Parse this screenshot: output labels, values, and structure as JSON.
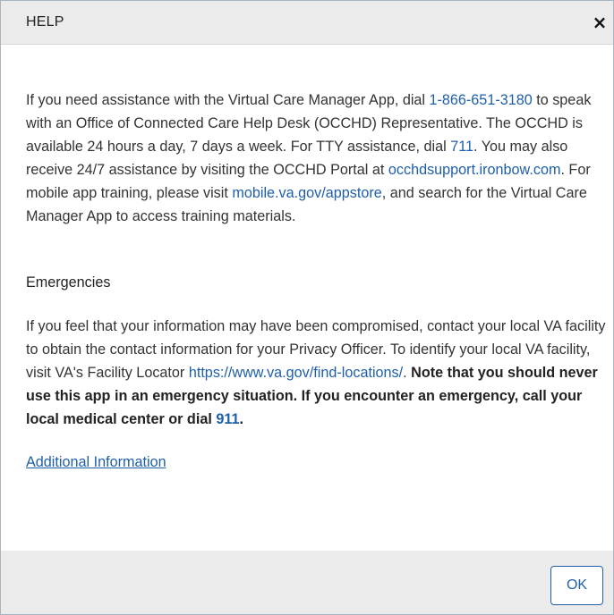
{
  "dialog": {
    "title": "HELP",
    "close_glyph": "×",
    "ok_label": "OK"
  },
  "help": {
    "t1": "If you need assistance with the Virtual Care Manager App, dial ",
    "phone": "1-866-651-3180",
    "t2": " to speak with an Office of Connected Care Help Desk (OCCHD) Representative. The OCCHD is available 24 hours a day, 7 days a week. For TTY assistance, dial ",
    "tty": "711",
    "t3": ". You may also receive 24/7 assistance by visiting the OCCHD Portal at ",
    "portal": "occhdsupport.ironbow.com",
    "t4": ". For mobile app training, please visit ",
    "appstore": "mobile.va.gov/appstore",
    "t5": ", and search for the Virtual Care Manager App to access training materials."
  },
  "emergencies": {
    "heading": "Emergencies",
    "t1": "If you feel that your information may have been compromised, contact your local VA facility to obtain the contact information for your Privacy Officer. To identify your local VA facility, visit VA's Facility Locator ",
    "locator": "https://www.va.gov/find-locations/",
    "t2": ". ",
    "bold1": "Note that you should never use this app in an emergency situation. If you encounter an emergency, call your local medical center or dial ",
    "emergency_number": "911",
    "bold2": "."
  },
  "additional_info_label": "Additional Information",
  "colors": {
    "link": "#1f5fa8",
    "header_bg": "#ebebeb",
    "text": "#333333"
  }
}
